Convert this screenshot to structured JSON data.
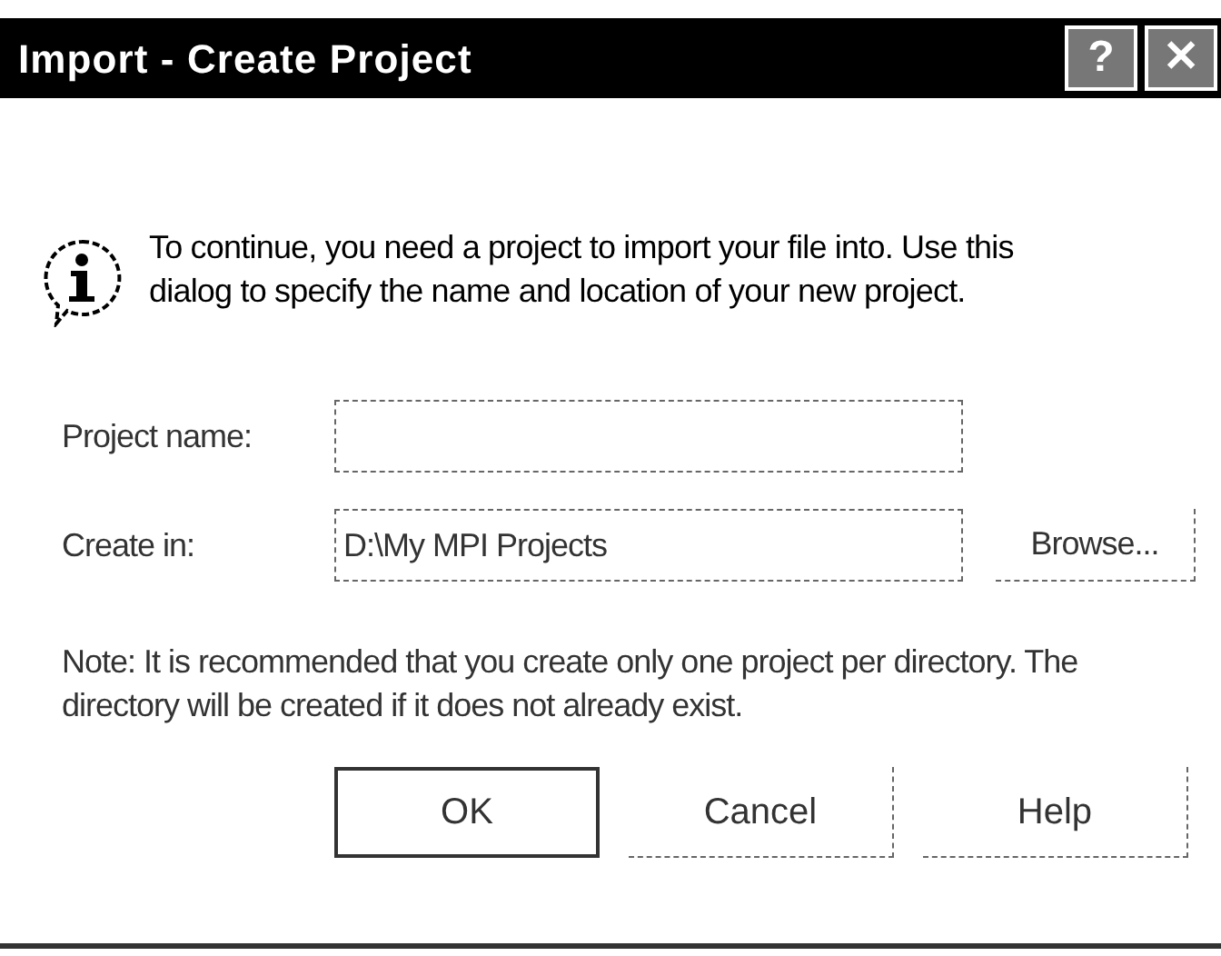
{
  "window": {
    "title": "Import - Create Project",
    "title_buttons": [
      "?",
      "✕"
    ]
  },
  "message": "To continue, you need a project to import your file into. Use this dialog to specify the name and location of your new project.",
  "fields": [
    {
      "label": "Project name:"
    },
    {
      "label": "Create in:",
      "value": "D:\\My MPI Projects",
      "button": "Browse..."
    }
  ],
  "note": "Note: It is recommended that you create only one project per directory.  The directory will be created if it does not already exist.",
  "buttons": [
    {
      "label": "OK",
      "default": true
    },
    {
      "label": "Cancel",
      "default": false
    },
    {
      "label": "Help",
      "default": false
    }
  ]
}
